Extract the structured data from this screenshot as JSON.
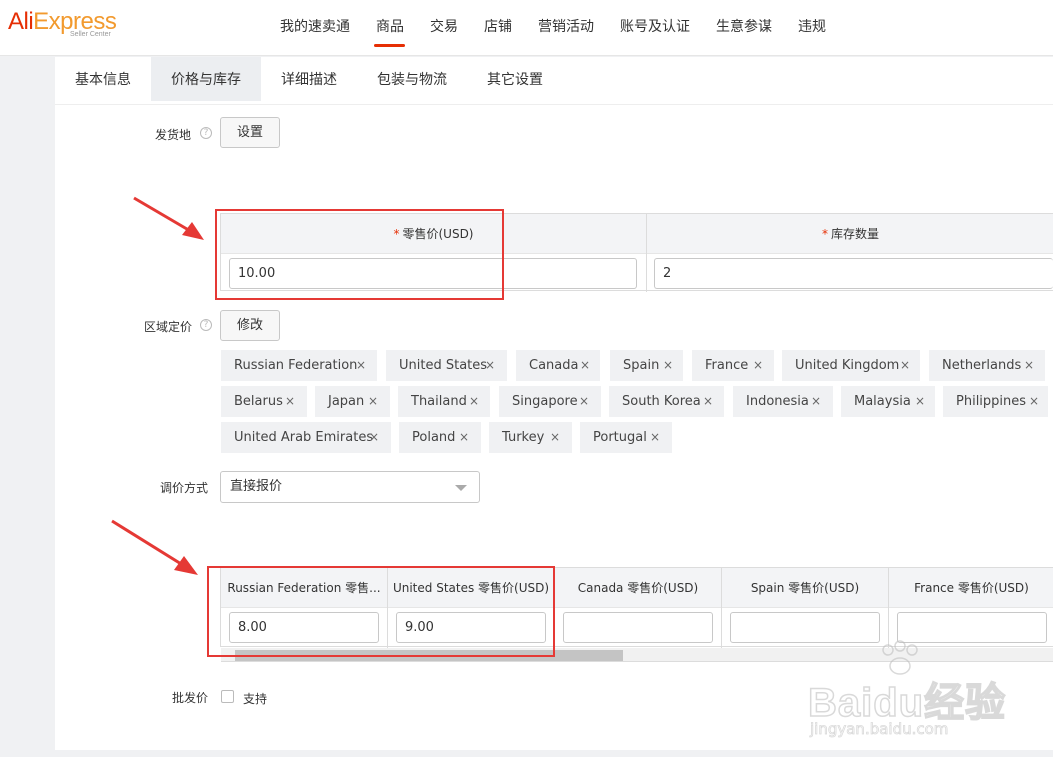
{
  "logo": {
    "brand_a": "Ali",
    "brand_b": "Express",
    "sub": "Seller Center"
  },
  "nav": {
    "items": [
      "我的速卖通",
      "商品",
      "交易",
      "店铺",
      "营销活动",
      "账号及认证",
      "生意参谋",
      "违规"
    ],
    "active": "商品"
  },
  "tabs": {
    "items": [
      "基本信息",
      "价格与库存",
      "详细描述",
      "包装与物流",
      "其它设置"
    ],
    "active": "价格与库存"
  },
  "shipping_origin": {
    "label": "发货地",
    "button": "设置"
  },
  "price_table": {
    "col_retail": "零售价(USD)",
    "col_stock": "库存数量",
    "retail_value": "10.00",
    "stock_value": "2"
  },
  "regional_pricing": {
    "label": "区域定价",
    "button": "修改",
    "countries": [
      "Russian Federation",
      "United States",
      "Canada",
      "Spain",
      "France",
      "United Kingdom",
      "Netherlands",
      "Belarus",
      "Japan",
      "Thailand",
      "Singapore",
      "South Korea",
      "Indonesia",
      "Malaysia",
      "Philippines",
      "United Arab Emirates",
      "Poland",
      "Turkey",
      "Portugal"
    ],
    "remove_glyph": "×"
  },
  "adjust_method": {
    "label": "调价方式",
    "value": "直接报价"
  },
  "region_table": {
    "headers": [
      "Russian Federation 零售...",
      "United States 零售价(USD)",
      "Canada 零售价(USD)",
      "Spain 零售价(USD)",
      "France 零售价(USD)"
    ],
    "values": [
      "8.00",
      "9.00",
      "",
      "",
      ""
    ]
  },
  "wholesale": {
    "label": "批发价",
    "option": "支持"
  },
  "watermark": {
    "main": "Baidu经验",
    "sub": "jingyan.baidu.com"
  },
  "colors": {
    "brand_red": "#e62e04",
    "brand_orange": "#f29a2e",
    "annotation_red": "#e53935"
  }
}
